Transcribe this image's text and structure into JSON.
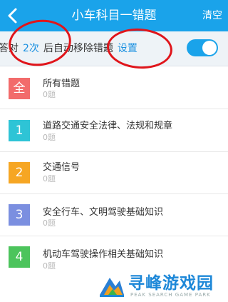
{
  "header": {
    "title": "小车科目一错题",
    "clear_label": "清空"
  },
  "setting": {
    "prefix": "答对",
    "count": "2次",
    "suffix": "后自动移除错题",
    "link": "设置",
    "toggle_on": true
  },
  "items": [
    {
      "badge": "全",
      "label": "所有错题",
      "count": "0题",
      "color": "#f26b6b"
    },
    {
      "badge": "1",
      "label": "道路交通安全法律、法规和规章",
      "count": "0题",
      "color": "#2ec4d6"
    },
    {
      "badge": "2",
      "label": "交通信号",
      "count": "0题",
      "color": "#f6a623"
    },
    {
      "badge": "3",
      "label": "安全行车、文明驾驶基础知识",
      "count": "0题",
      "color": "#7b8fe0"
    },
    {
      "badge": "4",
      "label": "机动车驾驶操作相关基础知识",
      "count": "0题",
      "color": "#4cc45c"
    }
  ],
  "watermark": {
    "title": "寻峰游戏园",
    "subtitle": "PEAK SEARCH GAME PARK"
  },
  "colors": {
    "header": "#1aa3ea",
    "highlight_ring": "#e0151b"
  }
}
